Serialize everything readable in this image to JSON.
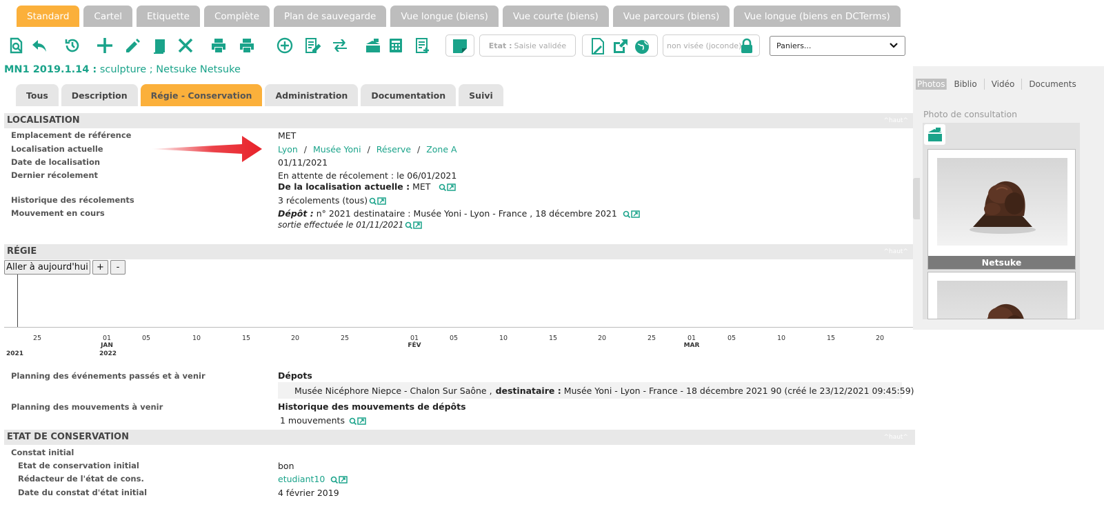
{
  "view_tabs": [
    "Standard",
    "Cartel",
    "Etiquette",
    "Complète",
    "Plan de sauvegarde",
    "Vue longue (biens)",
    "Vue courte (biens)",
    "Vue parcours (biens)",
    "Vue longue (biens en DCTerms)"
  ],
  "toolbar": {
    "state_label": "Etat :",
    "state_value": "Saisie validée",
    "visa_value": "non visée (joconde)",
    "basket_select": "Paniers..."
  },
  "record": {
    "id": "MN1 2019.1.14 :",
    "name": "sculpture ; Netsuke Netsuke"
  },
  "section_tabs": [
    "Tous",
    "Description",
    "Régie - Conservation",
    "Administration",
    "Documentation",
    "Suivi"
  ],
  "localisation": {
    "heading": "LOCALISATION",
    "haut": "^haut^",
    "labels": {
      "ref": "Emplacement de référence",
      "current": "Localisation actuelle",
      "date": "Date de localisation",
      "last": "Dernier récolement",
      "history": "Historique des récolements",
      "movement": "Mouvement en cours"
    },
    "ref_value": "MET",
    "current_path": [
      "Lyon",
      "Musée Yoni",
      "Réserve",
      "Zone A"
    ],
    "separator": "/",
    "date_value": "01/11/2021",
    "last_line1": "En attente de récolement : le 06/01/2021",
    "last_line2_bold": "De la localisation actuelle :",
    "last_line2_value": "MET",
    "history_value": "3 récolements (tous)",
    "movement_bold": "Dépôt :",
    "movement_value": "n° 2021 destinataire : Musée Yoni - Lyon - France , 18 décembre 2021",
    "movement_line2": "sortie effectuée le 01/11/2021"
  },
  "regie": {
    "heading": "RÉGIE",
    "haut": "^haut^",
    "today_button": "Aller à aujourd'hui",
    "zoom_in": "+",
    "zoom_out": "-",
    "ticks": [
      {
        "label": "25"
      },
      {
        "label": "01"
      },
      {
        "label": "05"
      },
      {
        "label": "10"
      },
      {
        "label": "15"
      },
      {
        "label": "20"
      },
      {
        "label": "25"
      },
      {
        "label": "01"
      },
      {
        "label": "05"
      },
      {
        "label": "10"
      },
      {
        "label": "15"
      },
      {
        "label": "20"
      },
      {
        "label": "25"
      },
      {
        "label": "01"
      },
      {
        "label": "05"
      },
      {
        "label": "10"
      },
      {
        "label": "15"
      },
      {
        "label": "20"
      }
    ],
    "months": [
      "JAN",
      "FÉV",
      "MAR"
    ],
    "years": [
      "2021",
      "2022"
    ],
    "planning_label": "Planning des événements passés et à venir",
    "planning_heading": "Dépots",
    "event_origin": "Musée Nicéphore Niepce - Chalon Sur Saône ,",
    "event_dest_bold": "destinataire :",
    "event_dest": "Musée Yoni - Lyon - France - 18 décembre 2021  90 (créé le 23/12/2021 09:45:59)",
    "moves_label": "Planning des mouvements à venir",
    "moves_heading": "Historique des mouvements de dépôts",
    "moves_value": "1 mouvements"
  },
  "conservation": {
    "heading": "ETAT DE CONSERVATION",
    "haut": "^haut^",
    "constat_label": "Constat initial",
    "etat_label": "Etat de conservation initial",
    "etat_value": "bon",
    "redacteur_label": "Rédacteur de l'état de cons.",
    "redacteur_value": "etudiant10",
    "date_label": "Date du constat d'état initial",
    "date_value": "4 février 2019"
  },
  "side_panel": {
    "tabs": [
      "Photos",
      "Biblio",
      "Vidéo",
      "Documents"
    ],
    "photo_label": "Photo de consultation",
    "photo_caption": "Netsuke"
  },
  "colors": {
    "accent": "#1aa38a",
    "active_tab": "#fbb03b",
    "inactive_tab": "#bdbdbd",
    "arrow": "#e8222a"
  }
}
